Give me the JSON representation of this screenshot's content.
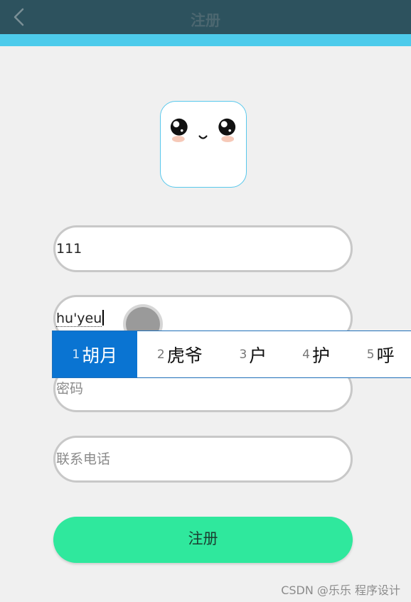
{
  "header": {
    "title": "注册",
    "back_icon": "chevron-left-icon",
    "bg_color": "#2d525e"
  },
  "accent_color": "#4dcbeb",
  "avatar": {
    "icon": "kawaii-face-icon"
  },
  "form": {
    "username_value": "111",
    "nickname_composition": "hu'yeu",
    "password_placeholder": "密码",
    "phone_placeholder": "联系电话"
  },
  "ime": {
    "candidates": [
      {
        "num": "1",
        "word": "胡月",
        "selected": true
      },
      {
        "num": "2",
        "word": "虎爷",
        "selected": false
      },
      {
        "num": "3",
        "word": "户",
        "selected": false
      },
      {
        "num": "4",
        "word": "护",
        "selected": false
      },
      {
        "num": "5",
        "word": "呼",
        "selected": false
      }
    ],
    "selected_color": "#0a74d2"
  },
  "submit": {
    "label": "注册",
    "color": "#2fe89d"
  },
  "watermark": "CSDN @乐乐 程序设计"
}
